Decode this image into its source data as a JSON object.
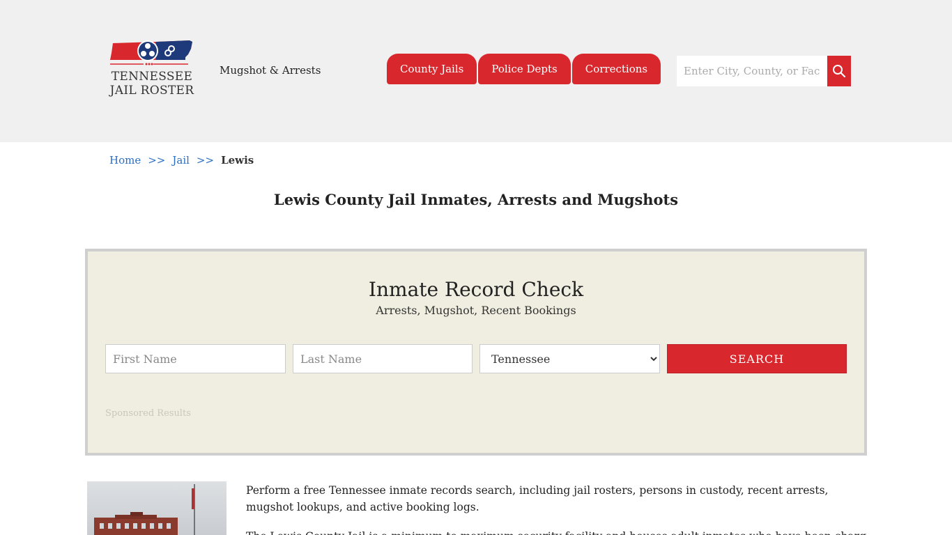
{
  "header": {
    "logo": {
      "line1": "TENNESSEE",
      "line2": "JAIL ROSTER"
    },
    "tagline": "Mugshot & Arrests",
    "nav": [
      "County Jails",
      "Police Depts",
      "Corrections"
    ],
    "search": {
      "placeholder": "Enter City, County, or Facility"
    }
  },
  "breadcrumb": {
    "home": "Home",
    "sep": ">>",
    "jail": "Jail",
    "current": "Lewis"
  },
  "page_title": "Lewis County Jail Inmates, Arrests and Mugshots",
  "record_check": {
    "title": "Inmate Record Check",
    "subtitle": "Arrests, Mugshot, Recent Bookings",
    "first_placeholder": "First Name",
    "last_placeholder": "Last Name",
    "state_selected": "Tennessee",
    "search_label": "SEARCH",
    "sponsored": "Sponsored Results"
  },
  "content": {
    "intro": "Perform a free Tennessee inmate records search, including jail rosters, persons in custody, recent arrests, mugshot lookups, and active booking logs.",
    "second": "The Lewis County Jail is a minimum to maximum security facility and houses adult inmates who have been charged"
  },
  "colors": {
    "accent": "#d9272e",
    "panel_bg": "#f0eee0",
    "link": "#2a6dc4"
  }
}
